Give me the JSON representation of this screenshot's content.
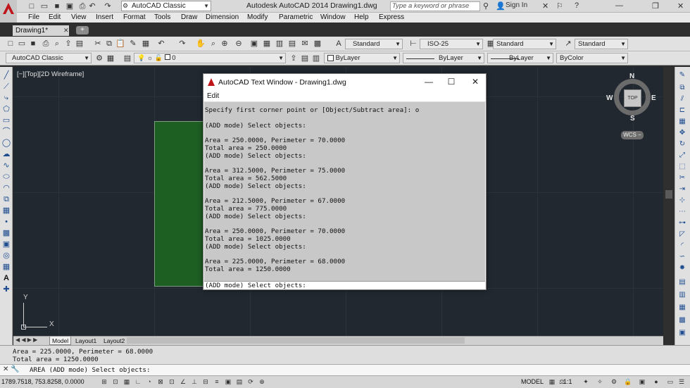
{
  "titlebar": {
    "workspace": "AutoCAD Classic",
    "app_title": "Autodesk AutoCAD 2014    Drawing1.dwg",
    "search_placeholder": "Type a keyword or phrase",
    "signin": "Sign In"
  },
  "menu": [
    "File",
    "Edit",
    "View",
    "Insert",
    "Format",
    "Tools",
    "Draw",
    "Dimension",
    "Modify",
    "Parametric",
    "Window",
    "Help",
    "Express"
  ],
  "tabs": {
    "drawing_tab": "Drawing1*",
    "new_tab": "+"
  },
  "toolbar": {
    "text_style": "Standard",
    "dim_style": "ISO-25",
    "table_style": "Standard",
    "mleader_style": "Standard",
    "workspace": "AutoCAD Classic",
    "layer": "0",
    "color": "ByLayer",
    "linetype": "ByLayer",
    "lineweight": "ByLayer",
    "plotstyle": "ByColor"
  },
  "viewport": {
    "label": "[−][Top][2D Wireframe]",
    "viewcube": {
      "top": "TOP",
      "n": "N",
      "s": "S",
      "e": "E",
      "w": "W",
      "wcs": "WCS −"
    },
    "ucs_x": "X",
    "ucs_y": "Y"
  },
  "layout_tabs": [
    "Model",
    "Layout1",
    "Layout2"
  ],
  "text_window": {
    "title": "AutoCAD Text Window - Drawing1.dwg",
    "menu_edit": "Edit",
    "lines": [
      "Specify first corner point or [Object/Subtract area]: o",
      "",
      "(ADD mode) Select objects:",
      "",
      "Area = 250.0000, Perimeter = 70.0000",
      "Total area = 250.0000",
      "(ADD mode) Select objects:",
      "",
      "Area = 312.5000, Perimeter = 75.0000",
      "Total area = 562.5000",
      "(ADD mode) Select objects:",
      "",
      "Area = 212.5000, Perimeter = 67.0000",
      "Total area = 775.0000",
      "(ADD mode) Select objects:",
      "",
      "Area = 250.0000, Perimeter = 70.0000",
      "Total area = 1025.0000",
      "(ADD mode) Select objects:",
      "",
      "Area = 225.0000, Perimeter = 68.0000",
      "Total area = 1250.0000"
    ],
    "input": "(ADD mode) Select objects:"
  },
  "command": {
    "history_1": "Area = 225.0000, Perimeter = 68.0000",
    "history_2": "Total area = 1250.0000",
    "prompt": "AREA (ADD mode) Select objects:"
  },
  "status": {
    "coords": "1789.7518, 753.8258, 0.0000",
    "model": "MODEL",
    "scale": "1:1"
  }
}
